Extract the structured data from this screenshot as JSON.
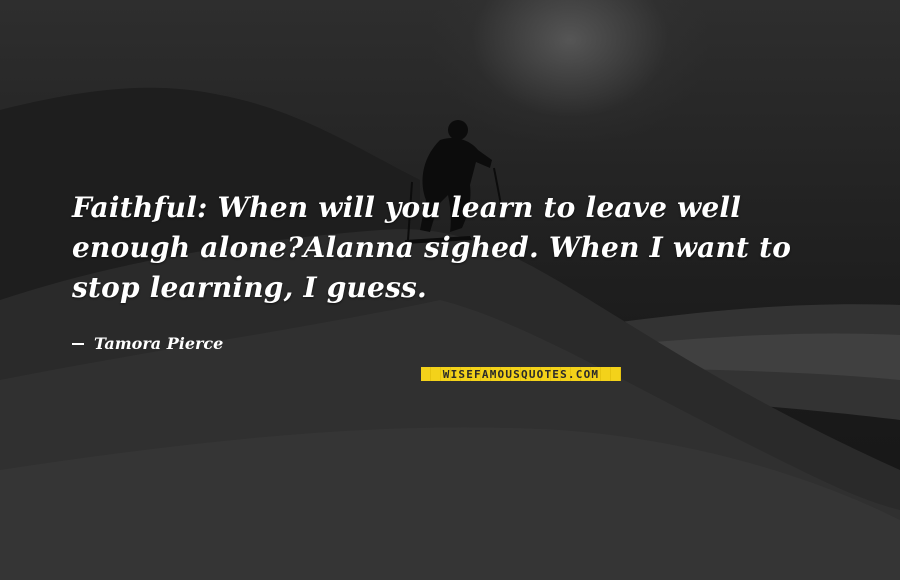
{
  "quote": {
    "text": "Faithful: When will you learn to leave well enough alone?Alanna sighed. When I want to stop learning, I guess."
  },
  "author": {
    "name": "Tamora Pierce"
  },
  "watermark": {
    "text": "WISEFAMOUSQUOTES.COM"
  },
  "colors": {
    "text": "#ffffff",
    "watermark_bg": "#f3d21a",
    "watermark_text": "#2a2a2a"
  }
}
